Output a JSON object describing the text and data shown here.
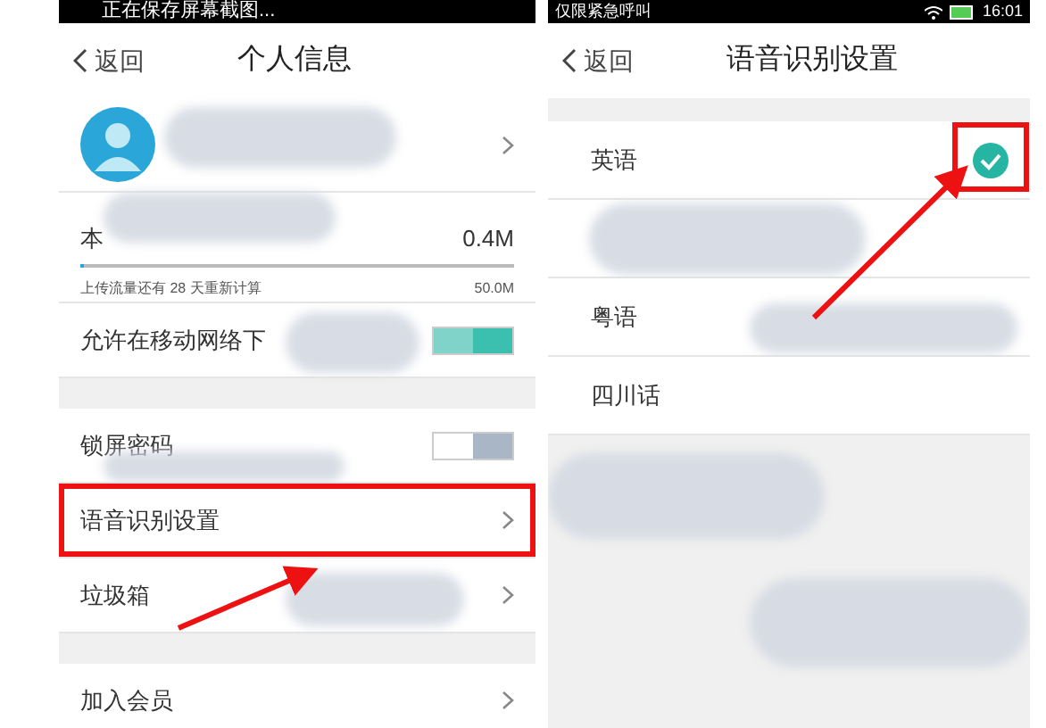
{
  "left_screen": {
    "status_bar": {
      "text": "正在保存屏幕截图..."
    },
    "header": {
      "back": "返回",
      "title": "个人信息"
    },
    "traffic": {
      "label": "本",
      "value": "0.4M",
      "level": 0.01,
      "note": "上传流量还有 28 天重新计算",
      "limit": "50.0M"
    },
    "sections": [
      [
        {
          "kind": "toggle",
          "label": "允许在移动网络下",
          "on": true
        }
      ],
      [
        {
          "kind": "toggle",
          "label": "锁屏密码",
          "on": false
        },
        {
          "kind": "link",
          "label": "语音识别设置",
          "highlighted": true
        },
        {
          "kind": "link",
          "label": "垃圾箱",
          "highlighted": false
        }
      ],
      [
        {
          "kind": "link",
          "label": "加入会员",
          "highlighted": false
        }
      ]
    ]
  },
  "right_screen": {
    "status_bar": {
      "text": "仅限紧急呼叫",
      "time": "16:01"
    },
    "header": {
      "back": "返回",
      "title": "语音识别设置"
    },
    "languages": [
      {
        "label": "英语",
        "selected": true
      },
      {
        "selected": false
      },
      {
        "label": "粤语",
        "selected": false
      },
      {
        "label": "四川话",
        "selected": false
      }
    ]
  }
}
